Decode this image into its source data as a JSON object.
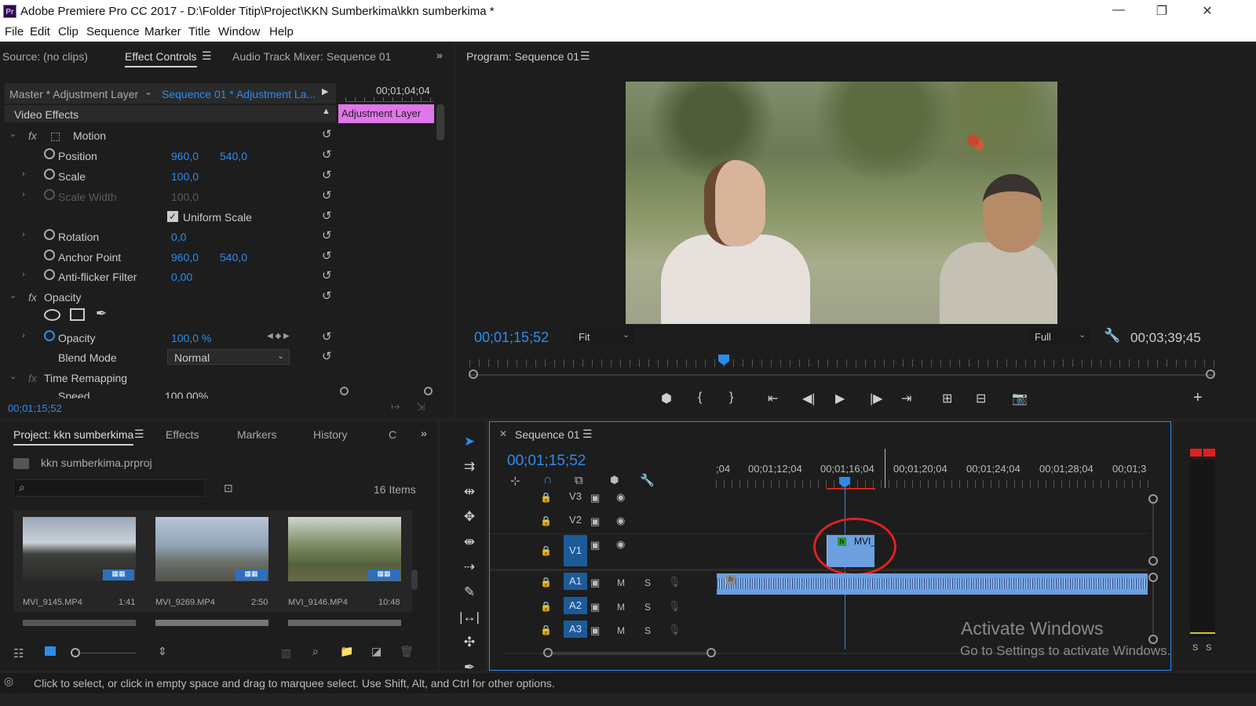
{
  "window": {
    "title": "Adobe Premiere Pro CC 2017 - D:\\Folder Titip\\Project\\KKN Sumberkima\\kkn sumberkima *",
    "logo": "Pr"
  },
  "menu": [
    "File",
    "Edit",
    "Clip",
    "Sequence",
    "Marker",
    "Title",
    "Window",
    "Help"
  ],
  "top_left_tabs": {
    "source": "Source: (no clips)",
    "effect_controls": "Effect Controls",
    "audio_mixer": "Audio Track Mixer: Sequence 01"
  },
  "effect_controls": {
    "master": "Master * Adjustment Layer",
    "sequence": "Sequence 01 * Adjustment La...",
    "timecode_end": "00;01;04;04",
    "clip_label": "Adjustment Layer",
    "video_effects": "Video Effects",
    "motion": "Motion",
    "position": {
      "label": "Position",
      "x": "960,0",
      "y": "540,0"
    },
    "scale": {
      "label": "Scale",
      "v": "100,0"
    },
    "scale_width": {
      "label": "Scale Width",
      "v": "100,0"
    },
    "uniform_scale": "Uniform Scale",
    "rotation": {
      "label": "Rotation",
      "v": "0,0"
    },
    "anchor": {
      "label": "Anchor Point",
      "x": "960,0",
      "y": "540,0"
    },
    "antiflicker": {
      "label": "Anti-flicker Filter",
      "v": "0,00"
    },
    "opacity_group": "Opacity",
    "opacity": {
      "label": "Opacity",
      "v": "100,0 %"
    },
    "blend": {
      "label": "Blend Mode",
      "v": "Normal"
    },
    "time_remap": "Time Remapping",
    "speed": {
      "label": "Speed",
      "v": "100,00%"
    },
    "timecode": "00;01;15;52"
  },
  "program": {
    "title": "Program: Sequence 01",
    "timecode": "00;01;15;52",
    "fit": "Fit",
    "quality": "Full",
    "duration": "00;03;39;45"
  },
  "project": {
    "tabs": [
      "Project: kkn sumberkima",
      "Effects",
      "Markers",
      "History",
      "C"
    ],
    "file": "kkn sumberkima.prproj",
    "items_count": "16 Items",
    "clips": [
      {
        "name": "MVI_9145.MP4",
        "dur": "1:41"
      },
      {
        "name": "MVI_9269.MP4",
        "dur": "2:50"
      },
      {
        "name": "MVI_9146.MP4",
        "dur": "10:48"
      }
    ]
  },
  "timeline": {
    "tab": "Sequence 01",
    "timecode": "00;01;15;52",
    "ruler": [
      ";04",
      "00;01;12;04",
      "00;01;16;04",
      "00;01;20;04",
      "00;01;24;04",
      "00;01;28;04",
      "00;01;3"
    ],
    "tracks": [
      "V3",
      "V2",
      "V1",
      "A1",
      "A2",
      "A3"
    ],
    "clip_label": "MVI_"
  },
  "watermark": {
    "title": "Activate Windows",
    "sub": "Go to Settings to activate Windows."
  },
  "meter": {
    "s1": "S",
    "s2": "S"
  },
  "status": "Click to select, or click in empty space and drag to marquee select. Use Shift, Alt, and Ctrl for other options.",
  "colors": {
    "accent": "#2d8ceb",
    "adjustment": "#e176e8",
    "clip": "#6b9fe0",
    "highlight": "#e02020"
  }
}
